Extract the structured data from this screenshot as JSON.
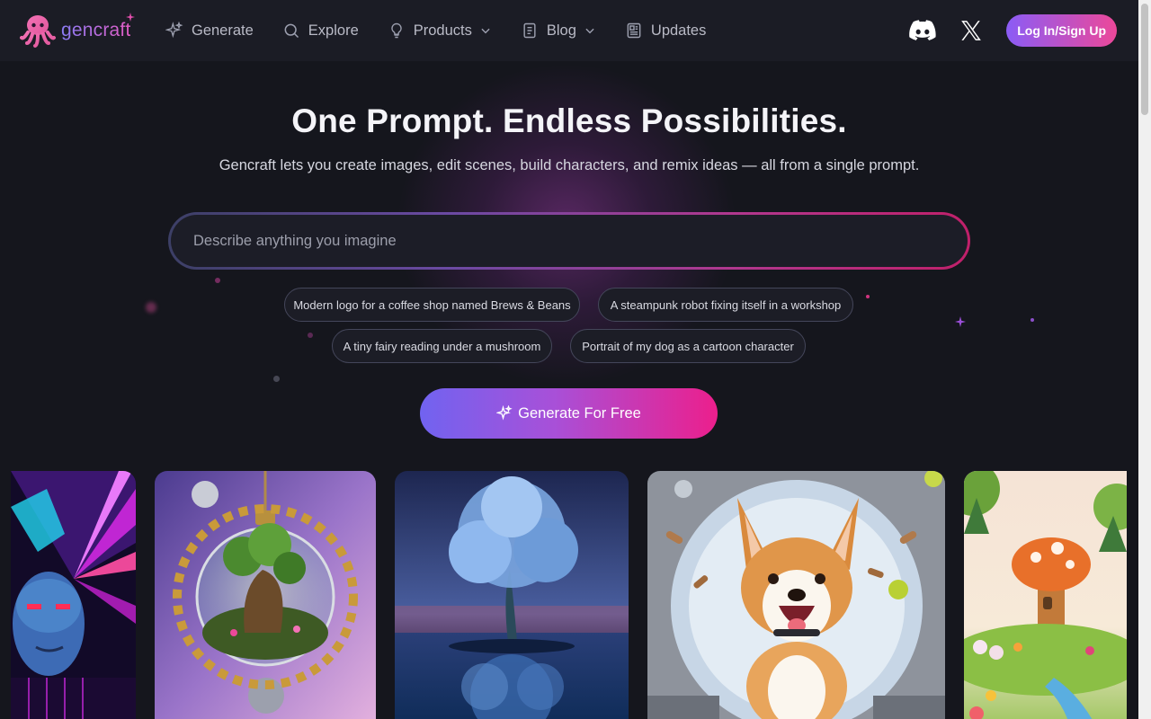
{
  "brand": {
    "name": "gencraft"
  },
  "nav": [
    {
      "label": "Generate",
      "icon": "sparkle-icon",
      "dropdown": false
    },
    {
      "label": "Explore",
      "icon": "search-icon",
      "dropdown": false
    },
    {
      "label": "Products",
      "icon": "lightbulb-icon",
      "dropdown": true
    },
    {
      "label": "Blog",
      "icon": "document-icon",
      "dropdown": true
    },
    {
      "label": "Updates",
      "icon": "newspaper-icon",
      "dropdown": false
    }
  ],
  "header_right": {
    "login_label": "Log In/Sign Up"
  },
  "hero": {
    "title": "One Prompt. Endless Possibilities.",
    "subtitle": "Gencraft lets you create images, edit scenes, build characters, and remix ideas — all from a single prompt.",
    "input_placeholder": "Describe anything you imagine",
    "input_value": ""
  },
  "suggestions": [
    "Modern logo for a coffee shop named Brews & Beans",
    "A steampunk robot fixing itself in a workshop",
    "A tiny fairy reading under a mushroom",
    "Portrait of my dog as a cartoon character"
  ],
  "cta": {
    "label": "Generate For Free",
    "icon": "sparkle-icon"
  },
  "gallery": [
    {
      "subject": "cyberpunk-face-image"
    },
    {
      "subject": "terrarium-ornament-image"
    },
    {
      "subject": "blue-tree-reflection-image"
    },
    {
      "subject": "corgi-spaceship-image"
    },
    {
      "subject": "mushroom-house-image"
    }
  ],
  "colors": {
    "background": "#15161d",
    "header": "#1b1c25",
    "accent_start": "#8b5cf6",
    "accent_end": "#ec4899"
  }
}
